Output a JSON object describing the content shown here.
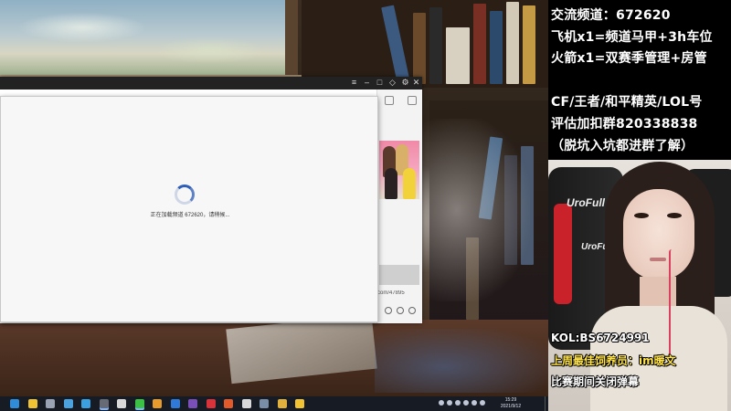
{
  "info_panel": {
    "lines": [
      "交流频道：672620",
      "飞机x1=频道马甲+3h车位",
      "火箭x1=双赛季管理+房管",
      "CF/王者/和平精英/LOL号",
      "评估加扣群820338838",
      "（脱坑入坑都进群了解）"
    ],
    "accent_color": "#ffffff"
  },
  "webcam": {
    "captions": [
      {
        "text": "KOL:BS6724991",
        "color": "#ffffff"
      },
      {
        "text": "上周最佳饲养员：im暖文",
        "color": "#ffe34a"
      },
      {
        "text": "比赛期间关闭弹幕",
        "color": "#ffffff"
      }
    ],
    "chair_brand": "UroFull"
  },
  "loading_dialog": {
    "message": "正在加载频道 672620，请稍候..."
  },
  "chat_window": {
    "side_link": "com/47895"
  },
  "taskbar": {
    "time": "15:29",
    "date": "2021/9/12",
    "icons": [
      {
        "name": "edge-icon",
        "color": "#2f8cd8"
      },
      {
        "name": "file-explorer-icon",
        "color": "#f1c232"
      },
      {
        "name": "settings-icon",
        "color": "#9aa3b3"
      },
      {
        "name": "store-icon",
        "color": "#4aa3df"
      },
      {
        "name": "qq-browser-icon",
        "color": "#3aa0e0"
      },
      {
        "name": "obs-icon",
        "color": "#666b75"
      },
      {
        "name": "circle-app-icon",
        "color": "#d8d8d8"
      },
      {
        "name": "wechat-icon",
        "color": "#3cbf45"
      },
      {
        "name": "orange-app-icon",
        "color": "#e89a2a"
      },
      {
        "name": "yy-icon",
        "color": "#2f7ad9"
      },
      {
        "name": "tools-icon",
        "color": "#7b4fb8"
      },
      {
        "name": "netease-music-icon",
        "color": "#d8323a"
      },
      {
        "name": "red-app-icon",
        "color": "#e25a2a"
      },
      {
        "name": "chrome-icon",
        "color": "#d9d9d9"
      },
      {
        "name": "media-icon",
        "color": "#7b8ea8"
      },
      {
        "name": "folder-icon",
        "color": "#e0b13c"
      },
      {
        "name": "yellow-app-icon",
        "color": "#f1c232"
      }
    ]
  }
}
